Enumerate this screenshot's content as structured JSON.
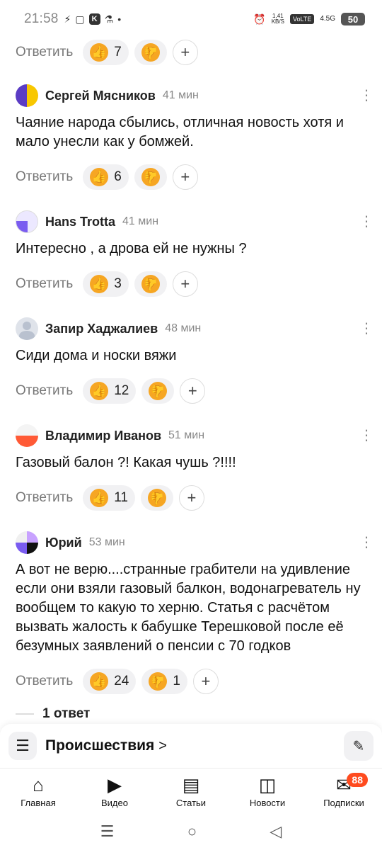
{
  "status_bar": {
    "time": "21:58",
    "net_speed_top": "1,41",
    "net_speed_unit": "KB/S",
    "volte": "VoLTE",
    "signal": "4.5G",
    "battery": "50"
  },
  "reply_label": "Ответить",
  "top_actions": {
    "likes": "7",
    "dislikes": ""
  },
  "comments": [
    {
      "author": "Сергей Мясников",
      "time": "41 мин",
      "text": "Чаяние народа сбылись, отличная новость хотя и мало унесли как у бомжей.",
      "likes": "6",
      "dislikes": "",
      "avatar_colors": [
        "#f8c700",
        "#5b3cc4"
      ]
    },
    {
      "author": "Hans Trotta",
      "time": "41 мин",
      "text": "Интересно , а дрова ей не нужны ?",
      "likes": "3",
      "dislikes": "",
      "avatar_colors": [
        "#ffffff",
        "#7a5cf0"
      ]
    },
    {
      "author": "Запир Хаджалиев",
      "time": "48 мин",
      "text": "Сиди дома и носки вяжи",
      "likes": "12",
      "dislikes": "",
      "avatar_colors": [
        "#dfe3ea",
        "#b9c1cf"
      ]
    },
    {
      "author": "Владимир Иванов",
      "time": "51 мин",
      "text": "Газовый балон ?! Какая чушь ?!!!!",
      "likes": "11",
      "dislikes": "",
      "avatar_colors": [
        "#ff5a36",
        "#ffffff"
      ]
    },
    {
      "author": "Юрий",
      "time": "53 мин",
      "text": "А вот не верю....странные грабители на удивление если они взяли газовый балкон, водонагреватель ну вообщем то какую то херню. Статья с расчётом вызвать жалость к бабушке Терешковой после её безумных заявлений о пенсии с 70 годков",
      "likes": "24",
      "dislikes": "1",
      "avatar_colors": [
        "#111111",
        "#c8a2ff"
      ]
    }
  ],
  "replies_count": "1 ответ",
  "rubric": {
    "title": "Происшествия",
    "arrow": ">"
  },
  "tabs": [
    {
      "label": "Главная",
      "icon": "home-icon"
    },
    {
      "label": "Видео",
      "icon": "video-icon"
    },
    {
      "label": "Статьи",
      "icon": "articles-icon"
    },
    {
      "label": "Новости",
      "icon": "news-icon"
    },
    {
      "label": "Подписки",
      "icon": "subscriptions-icon",
      "badge": "88"
    }
  ],
  "colors": {
    "accent": "#f6a623",
    "badge": "#ff4b1f",
    "pill_bg": "#f1f1f3"
  }
}
